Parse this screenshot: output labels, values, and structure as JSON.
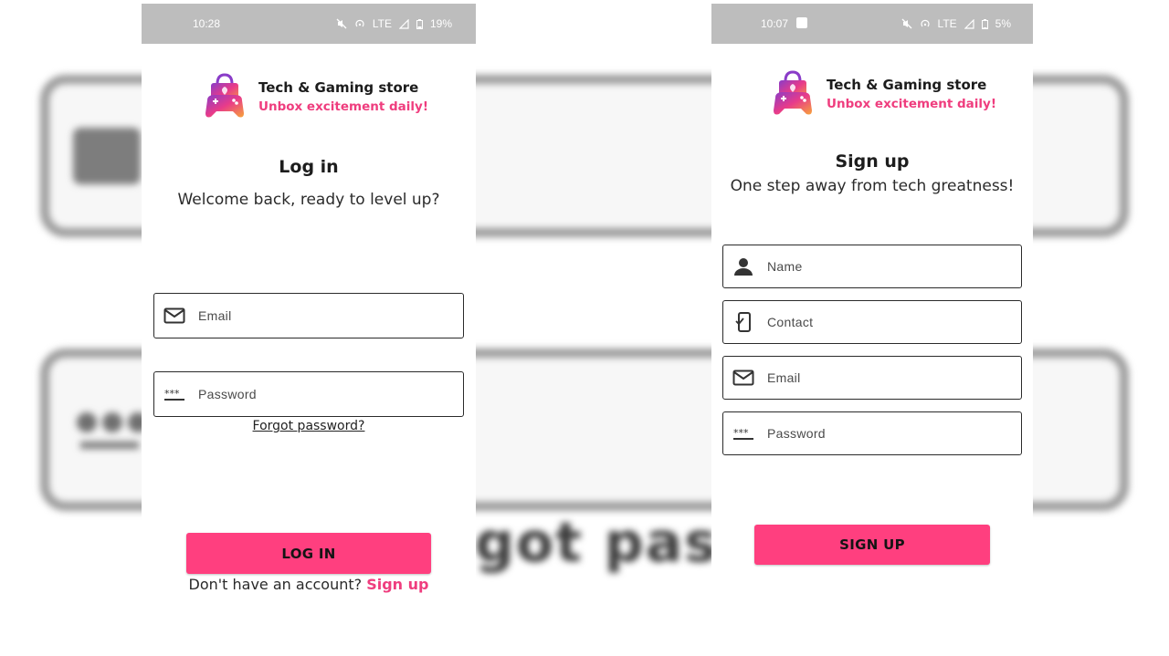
{
  "colors": {
    "accent": "#ff3f7f",
    "brand_pink": "#ef3d7e",
    "status_bar": "#bdbdbd",
    "text_dark": "#1c1c1c"
  },
  "background": {
    "blurred_text": "got passwo"
  },
  "login_screen": {
    "status": {
      "time": "10:28",
      "network": "LTE",
      "battery": "19%"
    },
    "brand": {
      "name": "Tech & Gaming store",
      "tagline": "Unbox excitement daily!"
    },
    "title": "Log in",
    "subtitle": "Welcome back, ready to level up?",
    "fields": {
      "email": {
        "placeholder": "Email",
        "icon": "mail-icon"
      },
      "password": {
        "placeholder": "Password",
        "icon": "password-icon"
      }
    },
    "forgot_password": "Forgot password?",
    "login_button": "LOG IN",
    "no_account_text": "Don't have an account?",
    "signup_link": "Sign up"
  },
  "signup_screen": {
    "status": {
      "time": "10:07",
      "network": "LTE",
      "battery": "5%"
    },
    "brand": {
      "name": "Tech & Gaming store",
      "tagline": "Unbox excitement daily!"
    },
    "title": "Sign up",
    "subtitle": "One step away from tech greatness!",
    "fields": {
      "name": {
        "placeholder": "Name",
        "icon": "person-icon"
      },
      "contact": {
        "placeholder": "Contact",
        "icon": "phone-icon"
      },
      "email": {
        "placeholder": "Email",
        "icon": "mail-icon"
      },
      "password": {
        "placeholder": "Password",
        "icon": "password-icon"
      }
    },
    "signup_button": "SIGN UP"
  }
}
